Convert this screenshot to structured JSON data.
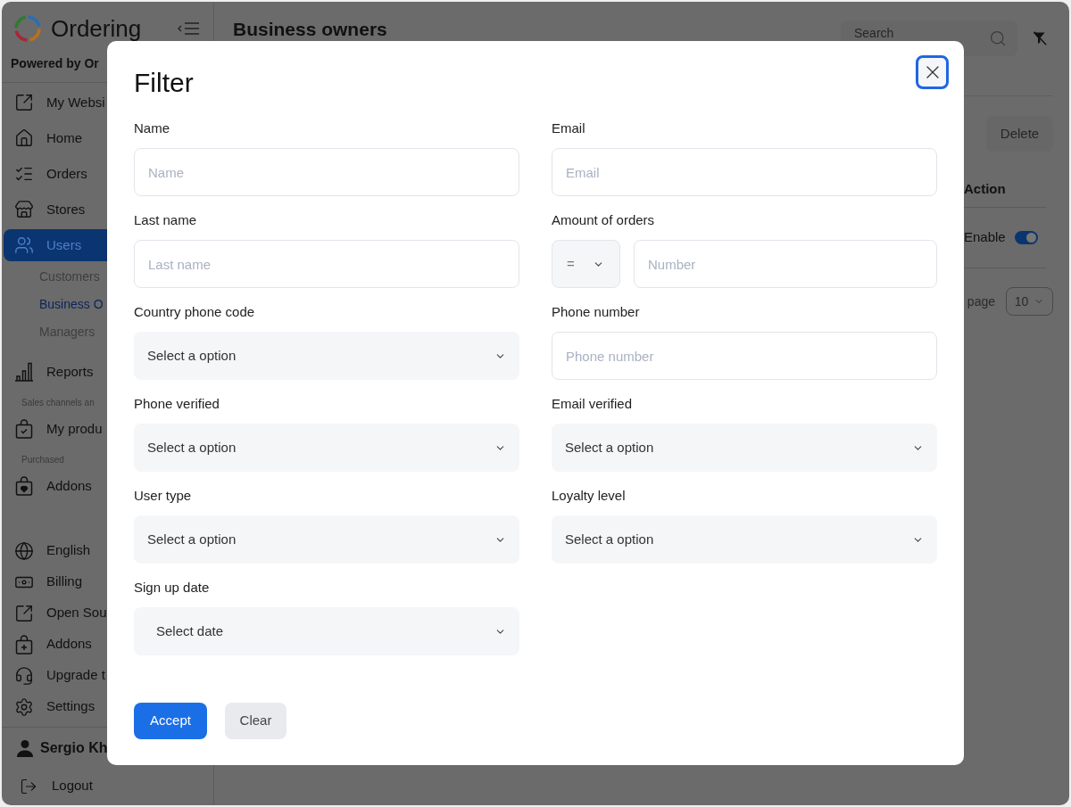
{
  "sidebar": {
    "brand": "Ordering",
    "tagline": "Powered by Or",
    "items": [
      {
        "kind": "link",
        "label": "My Websi",
        "selected": false
      },
      {
        "kind": "link",
        "label": "Home",
        "selected": false
      },
      {
        "kind": "link",
        "label": "Orders",
        "selected": false
      },
      {
        "kind": "link",
        "label": "Stores",
        "selected": false
      },
      {
        "kind": "link",
        "label": "Users",
        "selected": true,
        "children": [
          {
            "label": "Customers",
            "selected": false
          },
          {
            "label": "Business O",
            "selected": true
          },
          {
            "label": "Managers",
            "selected": false
          }
        ]
      },
      {
        "kind": "link",
        "label": "Reports",
        "selected": false
      },
      {
        "kind": "heading",
        "label": "Sales channels an"
      },
      {
        "kind": "link",
        "label": "My produ",
        "selected": false
      },
      {
        "kind": "heading",
        "label": "Purchased"
      },
      {
        "kind": "link",
        "label": "Addons",
        "selected": false
      }
    ],
    "bottom_items": [
      {
        "label": "English",
        "selected": false
      },
      {
        "label": "Billing",
        "selected": false
      },
      {
        "label": "Open Sou",
        "selected": false
      },
      {
        "label": "Addons",
        "selected": false
      },
      {
        "label": "Upgrade t",
        "selected": false
      },
      {
        "label": "Settings",
        "selected": false
      }
    ],
    "user": {
      "name": "Sergio Kh"
    },
    "logout": "Logout"
  },
  "main": {
    "title": "Business owners",
    "search": {
      "placeholder": "Search"
    },
    "delete_button": {
      "label": "Delete",
      "disabled": true
    },
    "table": {
      "columns": [
        {
          "label": "Action"
        }
      ],
      "rows": [
        {
          "status": "Enable",
          "on": true
        }
      ]
    },
    "pagination": {
      "label": "page",
      "page_size": "10"
    }
  },
  "modal": {
    "title": "Filter",
    "close": {
      "focused": true
    },
    "fields": [
      {
        "label": "Name",
        "kind": "text",
        "placeholder": "Name"
      },
      {
        "label": "Email",
        "kind": "text",
        "placeholder": "Email"
      },
      {
        "label": "Last name",
        "kind": "text",
        "placeholder": "Last name"
      },
      {
        "label": "Amount of orders",
        "kind": "compare",
        "operator": "=",
        "placeholder": "Number"
      },
      {
        "label": "Country phone code",
        "kind": "select",
        "placeholder": "Select a option"
      },
      {
        "label": "Phone number",
        "kind": "text",
        "placeholder": "Phone number"
      },
      {
        "label": "Phone verified",
        "kind": "select",
        "placeholder": "Select a option"
      },
      {
        "label": "Email verified",
        "kind": "select",
        "placeholder": "Select a option"
      },
      {
        "label": "User type",
        "kind": "select",
        "placeholder": "Select a option"
      },
      {
        "label": "Loyalty level",
        "kind": "select",
        "placeholder": "Select a option"
      },
      {
        "label": "Sign up date",
        "kind": "date",
        "placeholder": "Select date"
      }
    ],
    "buttons": [
      {
        "label": "Accept",
        "kind": "primary"
      },
      {
        "label": "Clear",
        "kind": "secondary"
      }
    ]
  }
}
